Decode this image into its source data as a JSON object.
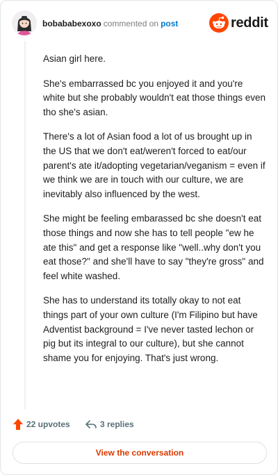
{
  "header": {
    "username": "bobababexoxo",
    "verb": "commented on",
    "post_link": "post",
    "brand": "reddit"
  },
  "comment": {
    "paragraphs": [
      "Asian girl here.",
      "She's embarrassed bc you enjoyed it and you're white but she probably wouldn't eat those things even tho she's asian.",
      "There's a lot of Asian food a lot of us brought up in the US that we don't eat/weren't forced to eat/our parent's ate it/adopting vegetarian/veganism = even if we think we are in touch with our culture, we are inevitably also influenced by the west.",
      "She might be feeling embarassed bc she doesn't eat those things and now she has to tell people \"ew he ate this\" and get a response like \"well..why don't you eat those?\" and she'll have to say \"they're gross\" and feel white washed.",
      "She has to understand its totally okay to not eat things part of your own culture (I'm Filipino but have Adventist background = I've never tasted lechon or pig but its integral to our culture), but she cannot shame you for enjoying. That's just wrong."
    ]
  },
  "actions": {
    "upvotes": "22 upvotes",
    "replies": "3 replies",
    "view_button": "View the conversation"
  },
  "colors": {
    "upvote_orange": "#ff4500",
    "link_blue": "#0079d3",
    "button_text": "#d93900"
  },
  "icons": {
    "avatar": "user-avatar",
    "logo": "reddit-alien-icon",
    "upvote": "upvote-arrow-icon",
    "reply": "reply-arrow-icon"
  }
}
